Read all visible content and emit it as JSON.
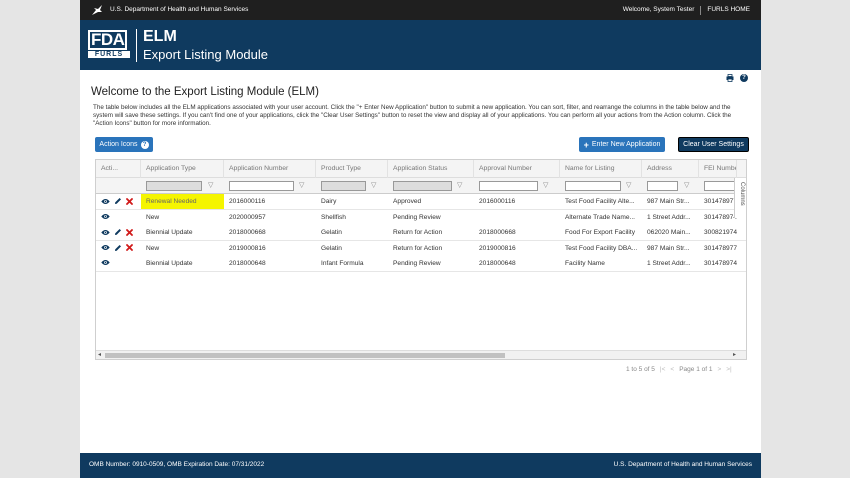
{
  "topbar": {
    "dept": "U.S. Department of Health and Human Services",
    "welcome": "Welcome, System Tester",
    "home_link": "FURLS HOME"
  },
  "banner": {
    "logo_top": "FDA",
    "logo_bottom": "FURLS",
    "app_short": "ELM",
    "app_full": "Export Listing Module"
  },
  "page": {
    "title": "Welcome to the Export Listing Module (ELM)",
    "description": "The table below includes all the ELM applications associated with your user account. Click the \"+ Enter New Application\" button to submit a new application. You can sort, filter, and rearrange the columns in the table below and the system will save these settings. If you can't find one of your applications, click the \"Clear User Settings\" button to reset the view and display all of your applications. You can perform all your actions from the Action column. Click the \"Action Icons\" button for more information."
  },
  "buttons": {
    "action_icons": "Action Icons",
    "enter_new": "Enter New Application",
    "clear_settings": "Clear User Settings"
  },
  "grid": {
    "columns": [
      "Acti...",
      "Application Type",
      "Application Number",
      "Product Type",
      "Application Status",
      "Approval Number",
      "Name for Listing",
      "Address",
      "FEI Numbe"
    ],
    "side_panel": "Columns",
    "rows": [
      {
        "actions": [
          "view",
          "edit",
          "delete"
        ],
        "type": "Renewal Needed",
        "number": "2016000116",
        "product": "Dairy",
        "status": "Approved",
        "approval": "2016000116",
        "name": "Test Food Facility Alte...",
        "address": "987 Main Str...",
        "fei": "301478977"
      },
      {
        "actions": [
          "view"
        ],
        "type": "New",
        "number": "2020000957",
        "product": "Shellfish",
        "status": "Pending Review",
        "approval": "",
        "name": "Alternate Trade Name...",
        "address": "1 Street Addr...",
        "fei": "301478974"
      },
      {
        "actions": [
          "view",
          "edit",
          "delete"
        ],
        "type": "Biennial Update",
        "number": "2018000668",
        "product": "Gelatin",
        "status": "Return for Action",
        "approval": "2018000668",
        "name": "Food For Export Facility",
        "address": "062020 Main...",
        "fei": "300821974"
      },
      {
        "actions": [
          "view",
          "edit",
          "delete"
        ],
        "type": "New",
        "number": "2019000816",
        "product": "Gelatin",
        "status": "Return for Action",
        "approval": "2019000816",
        "name": "Test Food Facility DBA...",
        "address": "987 Main Str...",
        "fei": "301478977"
      },
      {
        "actions": [
          "view"
        ],
        "type": "Biennial Update",
        "number": "2018000648",
        "product": "Infant Formula",
        "status": "Pending Review",
        "approval": "2018000648",
        "name": "Facility Name",
        "address": "1 Street Addr...",
        "fei": "301478974"
      }
    ]
  },
  "pager": {
    "summary": "1 to 5 of 5",
    "page": "Page 1 of 1"
  },
  "footer": {
    "omb": "OMB Number: 0910-0509, OMB Expiration Date: 07/31/2022",
    "dept": "U.S. Department of Health and Human Services"
  },
  "colors": {
    "navy": "#0f3a5f",
    "button_blue": "#2a74bb",
    "highlight": "#f5f500",
    "delete_red": "#d11a1a"
  }
}
